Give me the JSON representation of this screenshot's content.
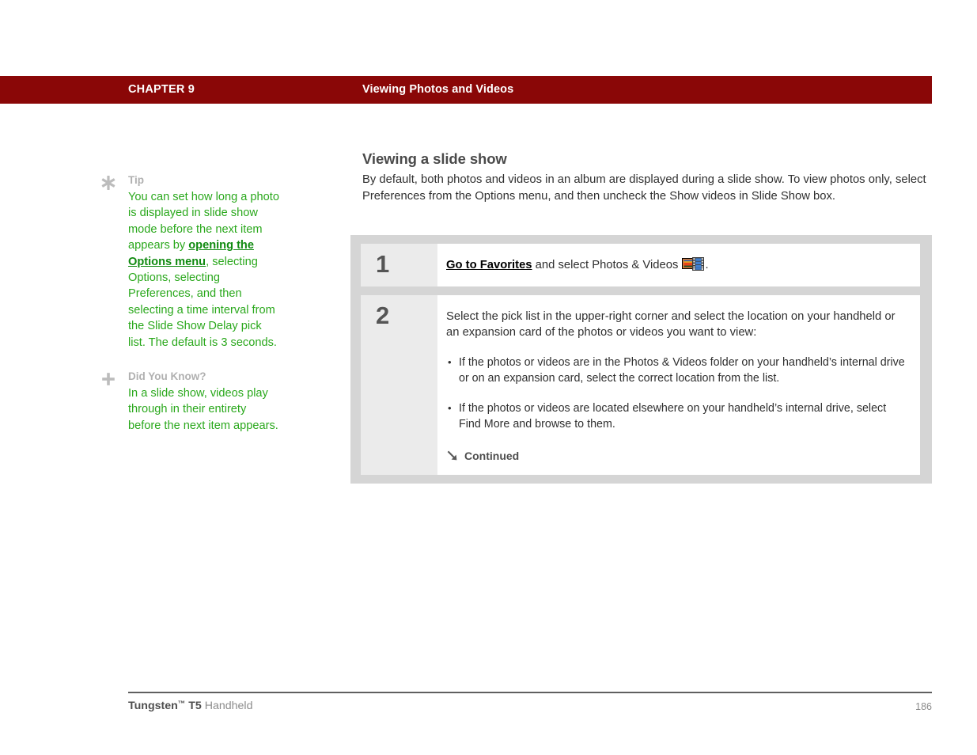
{
  "header": {
    "chapter_label": "CHAPTER 9",
    "chapter_title": "Viewing Photos and Videos",
    "bar_color": "#8a0707"
  },
  "sidebar": {
    "tips": [
      {
        "icon": "asterisk-icon",
        "heading": "Tip",
        "text_before_link": "You can set how long a photo is displayed in slide show mode before the next item appears by ",
        "link_text": "opening the Options menu",
        "text_after_link": ", selecting Options, selecting Preferences, and then selecting a time interval from the Slide Show Delay pick list. The default is 3 seconds.",
        "link_color": "#108a10",
        "text_color": "#2aa81c"
      },
      {
        "icon": "plus-icon",
        "heading": "Did You Know?",
        "text_before_link": "In a slide show, videos play through in their entirety before the next item appears.",
        "link_text": "",
        "text_after_link": "",
        "link_color": "#108a10",
        "text_color": "#2aa81c"
      }
    ]
  },
  "main": {
    "section_title": "Viewing a slide show",
    "section_intro": "By default, both photos and videos in an album are displayed during a slide show. To view photos only, select Preferences from the Options menu, and then uncheck the Show videos in Slide Show box."
  },
  "steps": [
    {
      "number": "1",
      "link_text": "Go to Favorites",
      "text_after_link": " and select Photos & Videos ",
      "icon": "photos-and-videos-icon",
      "text_end": "."
    },
    {
      "number": "2",
      "paragraph": "Select the pick list in the upper-right corner and select the location on your handheld or an expansion card of the photos or videos you want to view:",
      "bullets": [
        "If the photos or videos are in the Photos & Videos folder on your handheld’s internal drive or on an expansion card, select the correct location from the list.",
        "If the photos or videos are located elsewhere on your handheld’s internal drive, select Find More and browse to them."
      ],
      "continued_label": "Continued",
      "continued_icon": "arrow-down-right-icon"
    }
  ],
  "footer": {
    "brand": "Tungsten",
    "trademark": "™",
    "model": " T5",
    "product": " Handheld",
    "page_number": "186"
  }
}
